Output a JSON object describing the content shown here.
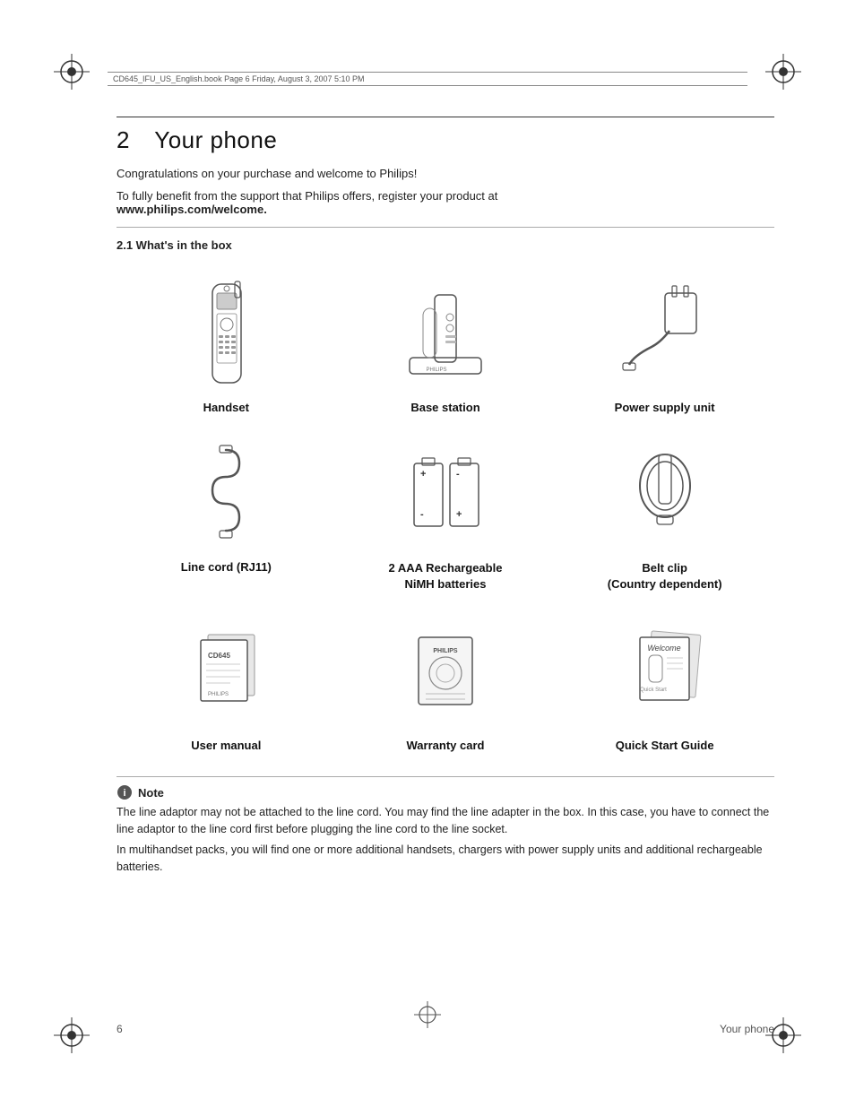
{
  "page": {
    "file_info": "CD645_IFU_US_English.book  Page 6  Friday, August 3, 2007  5:10 PM",
    "section_number": "2",
    "section_title": "Your phone",
    "intro1": "Congratulations on your purchase and welcome to Philips!",
    "intro2": "To fully benefit from the support that Philips offers, register your product at",
    "intro2_bold": "www.philips.com/welcome.",
    "subsection": "2.1   What's in the box",
    "items": [
      {
        "id": "handset",
        "label": "Handset"
      },
      {
        "id": "base-station",
        "label": "Base station"
      },
      {
        "id": "power-supply",
        "label": "Power supply unit"
      },
      {
        "id": "line-cord",
        "label": "Line cord (RJ11)"
      },
      {
        "id": "batteries",
        "label": "2 AAA Rechargeable\nNiMH batteries"
      },
      {
        "id": "belt-clip",
        "label": "Belt clip\n(Country dependent)"
      },
      {
        "id": "user-manual",
        "label": "User manual"
      },
      {
        "id": "warranty-card",
        "label": "Warranty card"
      },
      {
        "id": "quick-start",
        "label": "Quick Start Guide"
      }
    ],
    "note_title": "Note",
    "note_text1": "The line adaptor may not be attached to the line cord. You may find the line adapter in the box. In this case, you have to connect the line adaptor to the line cord first before plugging the line cord to the line socket.",
    "note_text2": "In multihandset packs, you will find one or more additional handsets, chargers with power supply units and additional rechargeable batteries.",
    "footer_page": "6",
    "footer_section": "Your phone"
  }
}
